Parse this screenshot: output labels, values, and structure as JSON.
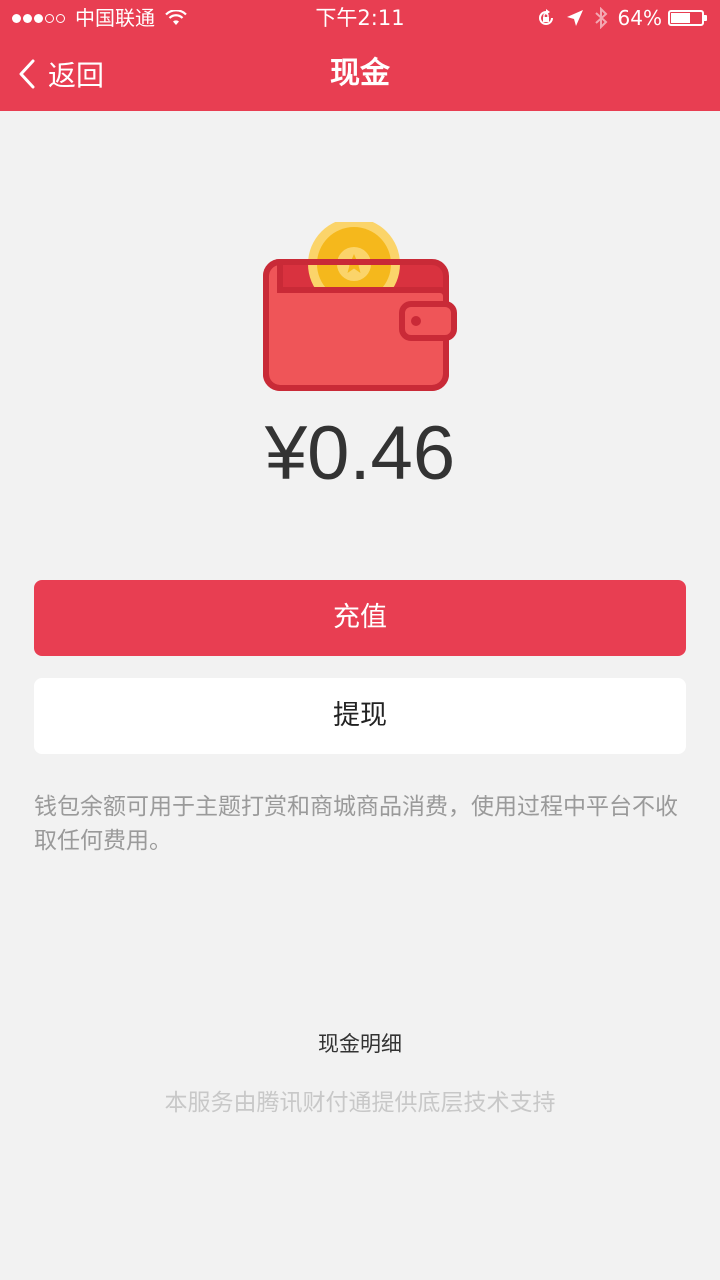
{
  "status_bar": {
    "carrier": "中国联通",
    "time": "下午2:11",
    "battery_text": "64%",
    "battery_level": 0.64,
    "signal_bars_filled": 3,
    "signal_bars_total": 5,
    "icons": [
      "wifi-icon",
      "orientation-lock-icon",
      "location-icon",
      "bluetooth-icon",
      "battery-icon"
    ]
  },
  "nav": {
    "back_label": "返回",
    "title": "现金"
  },
  "wallet": {
    "icon": "wallet-icon",
    "amount": "¥0.46"
  },
  "actions": {
    "recharge_label": "充值",
    "withdraw_label": "提现"
  },
  "notice": "钱包余额可用于主题打赏和商城商品消费，使用过程中平台不收取任何费用。",
  "details_link": "现金明细",
  "footer": "本服务由腾讯财付通提供底层技术支持",
  "colors": {
    "brand": "#e83e52",
    "background": "#f2f2f2",
    "coin": "#f7c12c"
  }
}
